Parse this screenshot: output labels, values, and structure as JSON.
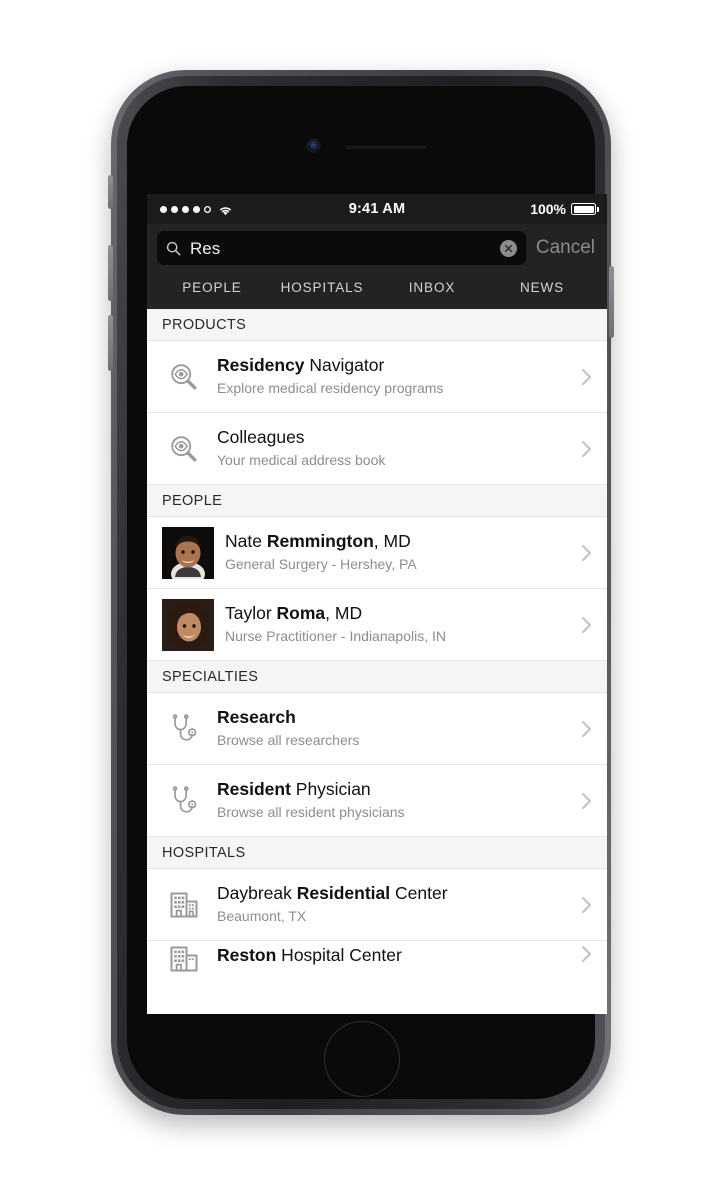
{
  "status_bar": {
    "signal_dots_filled": 4,
    "signal_dots_total": 5,
    "wifi_icon": "wifi-icon",
    "time": "9:41 AM",
    "battery_pct": "100%",
    "battery_level": 100
  },
  "search": {
    "icon": "search-icon",
    "value": "Res",
    "placeholder": "Search",
    "clear_icon": "clear-circle-icon",
    "cancel_label": "Cancel"
  },
  "tabs": [
    {
      "label": "PEOPLE",
      "active": false
    },
    {
      "label": "HOSPITALS",
      "active": false
    },
    {
      "label": "INBOX",
      "active": false
    },
    {
      "label": "NEWS",
      "active": false
    }
  ],
  "sections": [
    {
      "header": "PRODUCTS",
      "rows": [
        {
          "icon": "magnifier-eye-icon",
          "title_bold": "Residency",
          "title_rest": " Navigator",
          "subtitle": "Explore medical residency programs",
          "chevron": "chevron-right-icon"
        },
        {
          "icon": "magnifier-eye-icon",
          "title_bold": "",
          "title_rest": "Colleagues",
          "subtitle": "Your medical address book",
          "chevron": "chevron-right-icon"
        }
      ]
    },
    {
      "header": "PEOPLE",
      "rows": [
        {
          "icon": "avatar-photo",
          "avatar": "male-portrait",
          "title_pre": "Nate ",
          "title_bold": "Remmington",
          "title_rest": ", MD",
          "subtitle": "General Surgery - Hershey, PA",
          "chevron": "chevron-right-icon"
        },
        {
          "icon": "avatar-photo",
          "avatar": "female-portrait",
          "title_pre": "Taylor ",
          "title_bold": "Roma",
          "title_rest": ", MD",
          "subtitle": "Nurse Practitioner - Indianapolis, IN",
          "chevron": "chevron-right-icon"
        }
      ]
    },
    {
      "header": "SPECIALTIES",
      "rows": [
        {
          "icon": "stethoscope-icon",
          "title_bold": "Research",
          "title_rest": "",
          "subtitle": "Browse all researchers",
          "chevron": "chevron-right-icon"
        },
        {
          "icon": "stethoscope-icon",
          "title_bold": "Resident",
          "title_rest": " Physician",
          "subtitle": "Browse all resident physicians",
          "chevron": "chevron-right-icon"
        }
      ]
    },
    {
      "header": "HOSPITALS",
      "rows": [
        {
          "icon": "hospital-building-icon",
          "title_pre": "Daybreak ",
          "title_bold": "Residential",
          "title_rest": " Center",
          "subtitle": "Beaumont, TX",
          "chevron": "chevron-right-icon"
        },
        {
          "icon": "hospital-building-icon",
          "title_bold": "Reston",
          "title_rest": " Hospital Center",
          "subtitle": "",
          "chevron": "chevron-right-icon",
          "clipped": true
        }
      ]
    }
  ],
  "colors": {
    "nav_bg": "#232323",
    "status_bg": "#1c1c1c",
    "section_header_bg": "#f5f5f5",
    "row_bg": "#ffffff",
    "subtitle": "#8d8d8d",
    "icon_gray": "#9a9a9a",
    "chevron_gray": "#c2c2c2"
  }
}
